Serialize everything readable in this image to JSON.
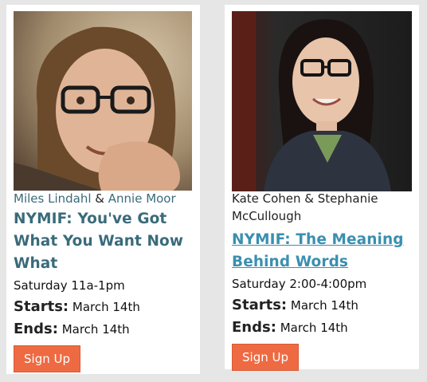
{
  "cards": [
    {
      "authors": [
        {
          "name": "Miles Lindahl",
          "linked": true
        },
        {
          "name": "Annie Moor",
          "linked": true
        }
      ],
      "separator": " & ",
      "title": "NYMIF: You've Got What You Want Now What",
      "schedule": "Saturday 11a-1pm",
      "starts_label": "Starts:",
      "starts_value": "March 14th",
      "ends_label": "Ends:",
      "ends_value": "March 14th",
      "signup_label": "Sign Up"
    },
    {
      "authors_text": "Kate Cohen & Stephanie McCullough",
      "title": "NYMIF: The Meaning Behind Words",
      "schedule": "Saturday 2:00-4:00pm",
      "starts_label": "Starts:",
      "starts_value": "March 14th",
      "ends_label": "Ends:",
      "ends_value": "March 14th",
      "signup_label": "Sign Up"
    }
  ],
  "colors": {
    "author_link": "#3a6b7a",
    "title": "#3a6b7a",
    "title_link": "#3a8fb0",
    "button": "#ee6a42",
    "background": "#e6e6e6"
  }
}
